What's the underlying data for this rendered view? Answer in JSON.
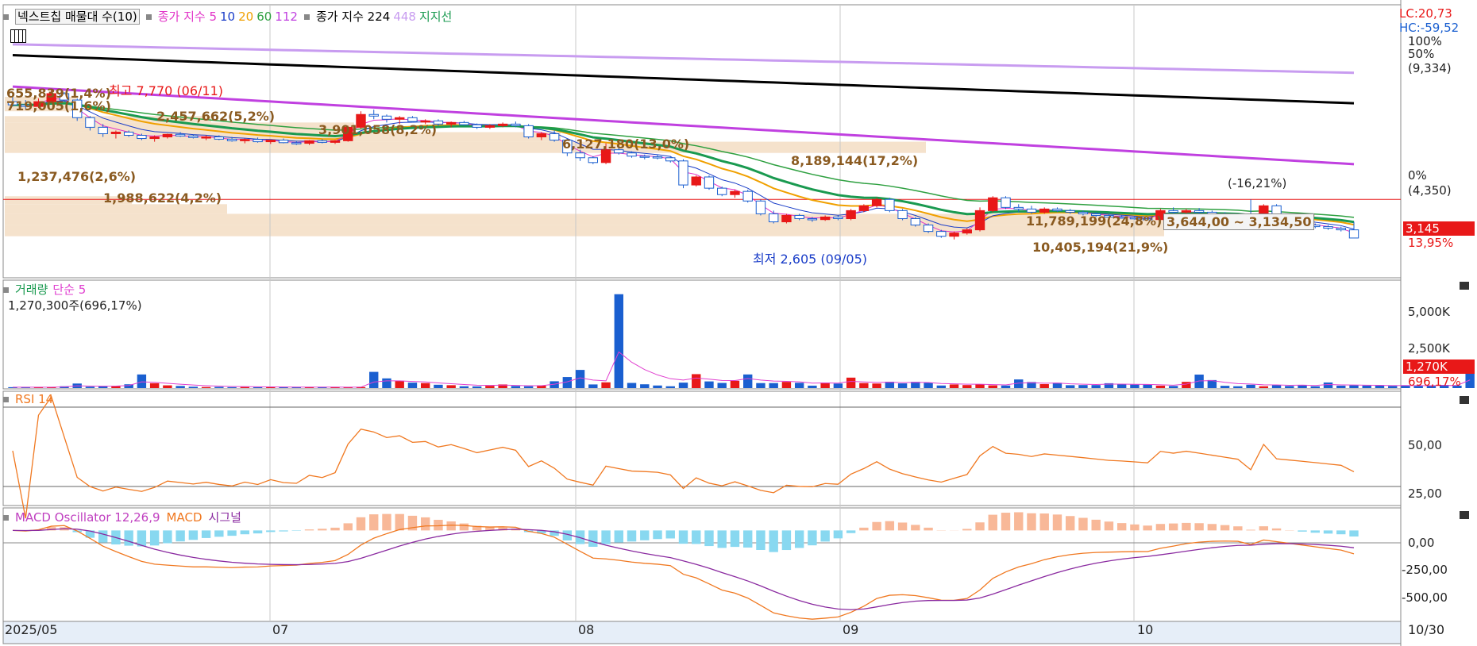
{
  "colors": {
    "up": "#e81818",
    "down": "#1a5fd0",
    "ma5": "#e234c8",
    "ma10": "#1a3dc8",
    "ma20": "#f0a000",
    "ma60": "#2ea040",
    "ma112": "#c040e0",
    "ma224": "#000000",
    "ma448": "#c89cf0",
    "support": "#1a9a50",
    "vol_ma": "#e040d0",
    "rsi": "#f07820",
    "macd": "#f07820",
    "signal": "#8a2aa0",
    "osc_pos": "#f8b898",
    "osc_neg": "#88d8f0",
    "profile": "#f5e2cc",
    "grid": "#c8c8c8"
  },
  "main_legend": {
    "profile_label": "넥스트칩 매물대 수(10)",
    "ma_prefix": "종가 지수 5",
    "ma10": "10",
    "ma20": "20",
    "ma60": "60",
    "ma112": "112",
    "ma224_label": "종가 지수 224",
    "ma448": "448",
    "support_label": "지지선"
  },
  "main_annotations": {
    "lc": "LC:20,73",
    "hc": "HC:-59,52",
    "high": "최고 7,770 (06/11)",
    "low": "최저 2,605 (09/05)",
    "change": "(-16,21%)",
    "range_box": "3,644,00 ~ 3,134,50",
    "price_badge": "3,145",
    "price_pct": "13,95%"
  },
  "profile_labels": [
    "655,839(1,4%)",
    "719,005(1,6%)",
    "2,457,662(5,2%)",
    "3,901,058(8,2%)",
    "6,127,180(13,0%)",
    "8,189,144(17,2%)",
    "1,237,476(2,6%)",
    "1,988,622(4,2%)",
    "11,789,199(24,8%)",
    "10,405,194(21,9%)"
  ],
  "price_axis": [
    "100%",
    "50%",
    "(9,334)",
    "0%",
    "(4,350)"
  ],
  "volume_panel": {
    "title": "거래량",
    "ma_label": "단순 5",
    "value": "1,270,300주(696,17%)",
    "axis": [
      "5,000K",
      "2,500K"
    ],
    "badge": "1,270K",
    "badge_pct": "696,17%"
  },
  "rsi_panel": {
    "title": "RSI 14",
    "axis": [
      "50,00",
      "25,00"
    ]
  },
  "macd_panel": {
    "title": "MACD Oscillator 12,26,9",
    "macd_label": "MACD",
    "signal_label": "시그널",
    "axis": [
      "0,00",
      "-250,00",
      "-500,00"
    ]
  },
  "x_axis": [
    "2025/05",
    "07",
    "08",
    "09",
    "10",
    "10/30"
  ],
  "chart_data": [
    {
      "type": "candlestick",
      "title": "넥스트칩",
      "ylim": [
        2400,
        9334
      ],
      "candles": [
        {
          "o": 7400,
          "h": 7600,
          "l": 7250,
          "c": 7300
        },
        {
          "o": 7300,
          "h": 7450,
          "l": 7150,
          "c": 7250
        },
        {
          "o": 7250,
          "h": 7500,
          "l": 7200,
          "c": 7400
        },
        {
          "o": 7400,
          "h": 7770,
          "l": 7350,
          "c": 7650
        },
        {
          "o": 7650,
          "h": 7700,
          "l": 7400,
          "c": 7450
        },
        {
          "o": 7450,
          "h": 7500,
          "l": 6800,
          "c": 6900
        },
        {
          "o": 6900,
          "h": 6950,
          "l": 6500,
          "c": 6600
        },
        {
          "o": 6600,
          "h": 6700,
          "l": 6300,
          "c": 6400
        },
        {
          "o": 6400,
          "h": 6500,
          "l": 6250,
          "c": 6450
        },
        {
          "o": 6450,
          "h": 6500,
          "l": 6300,
          "c": 6350
        },
        {
          "o": 6350,
          "h": 6400,
          "l": 6200,
          "c": 6250
        },
        {
          "o": 6250,
          "h": 6350,
          "l": 6150,
          "c": 6300
        },
        {
          "o": 6300,
          "h": 6400,
          "l": 6250,
          "c": 6380
        },
        {
          "o": 6380,
          "h": 6450,
          "l": 6300,
          "c": 6330
        },
        {
          "o": 6330,
          "h": 6380,
          "l": 6250,
          "c": 6280
        },
        {
          "o": 6280,
          "h": 6350,
          "l": 6200,
          "c": 6300
        },
        {
          "o": 6300,
          "h": 6350,
          "l": 6200,
          "c": 6230
        },
        {
          "o": 6230,
          "h": 6300,
          "l": 6150,
          "c": 6180
        },
        {
          "o": 6180,
          "h": 6250,
          "l": 6100,
          "c": 6220
        },
        {
          "o": 6220,
          "h": 6280,
          "l": 6120,
          "c": 6150
        },
        {
          "o": 6150,
          "h": 6220,
          "l": 6080,
          "c": 6200
        },
        {
          "o": 6200,
          "h": 6250,
          "l": 6100,
          "c": 6120
        },
        {
          "o": 6120,
          "h": 6180,
          "l": 6050,
          "c": 6100
        },
        {
          "o": 6100,
          "h": 6200,
          "l": 6050,
          "c": 6180
        },
        {
          "o": 6180,
          "h": 6230,
          "l": 6100,
          "c": 6130
        },
        {
          "o": 6130,
          "h": 6200,
          "l": 6080,
          "c": 6180
        },
        {
          "o": 6180,
          "h": 6650,
          "l": 6150,
          "c": 6600
        },
        {
          "o": 6600,
          "h": 7100,
          "l": 6550,
          "c": 7000
        },
        {
          "o": 7000,
          "h": 7150,
          "l": 6850,
          "c": 6950
        },
        {
          "o": 6950,
          "h": 7000,
          "l": 6750,
          "c": 6850
        },
        {
          "o": 6850,
          "h": 6950,
          "l": 6700,
          "c": 6900
        },
        {
          "o": 6900,
          "h": 6950,
          "l": 6750,
          "c": 6780
        },
        {
          "o": 6780,
          "h": 6850,
          "l": 6700,
          "c": 6800
        },
        {
          "o": 6800,
          "h": 6850,
          "l": 6650,
          "c": 6700
        },
        {
          "o": 6700,
          "h": 6780,
          "l": 6600,
          "c": 6750
        },
        {
          "o": 6750,
          "h": 6800,
          "l": 6650,
          "c": 6680
        },
        {
          "o": 6680,
          "h": 6720,
          "l": 6550,
          "c": 6600
        },
        {
          "o": 6600,
          "h": 6700,
          "l": 6550,
          "c": 6650
        },
        {
          "o": 6650,
          "h": 6750,
          "l": 6600,
          "c": 6700
        },
        {
          "o": 6700,
          "h": 6780,
          "l": 6600,
          "c": 6650
        },
        {
          "o": 6650,
          "h": 6700,
          "l": 6250,
          "c": 6300
        },
        {
          "o": 6300,
          "h": 6450,
          "l": 6200,
          "c": 6400
        },
        {
          "o": 6400,
          "h": 6500,
          "l": 6150,
          "c": 6200
        },
        {
          "o": 6200,
          "h": 6250,
          "l": 5700,
          "c": 5800
        },
        {
          "o": 5800,
          "h": 5900,
          "l": 5550,
          "c": 5650
        },
        {
          "o": 5650,
          "h": 5700,
          "l": 5450,
          "c": 5500
        },
        {
          "o": 5500,
          "h": 6100,
          "l": 5450,
          "c": 5900
        },
        {
          "o": 5900,
          "h": 6050,
          "l": 5750,
          "c": 5800
        },
        {
          "o": 5800,
          "h": 5850,
          "l": 5650,
          "c": 5700
        },
        {
          "o": 5700,
          "h": 5750,
          "l": 5600,
          "c": 5680
        },
        {
          "o": 5680,
          "h": 5750,
          "l": 5600,
          "c": 5650
        },
        {
          "o": 5650,
          "h": 5700,
          "l": 5500,
          "c": 5550
        },
        {
          "o": 5550,
          "h": 5600,
          "l": 4700,
          "c": 4800
        },
        {
          "o": 4800,
          "h": 5100,
          "l": 4750,
          "c": 5050
        },
        {
          "o": 5050,
          "h": 5100,
          "l": 4650,
          "c": 4700
        },
        {
          "o": 4700,
          "h": 4750,
          "l": 4450,
          "c": 4500
        },
        {
          "o": 4500,
          "h": 4650,
          "l": 4400,
          "c": 4600
        },
        {
          "o": 4600,
          "h": 4650,
          "l": 4250,
          "c": 4300
        },
        {
          "o": 4300,
          "h": 4350,
          "l": 3850,
          "c": 3900
        },
        {
          "o": 3900,
          "h": 4000,
          "l": 3600,
          "c": 3650
        },
        {
          "o": 3650,
          "h": 3900,
          "l": 3600,
          "c": 3850
        },
        {
          "o": 3850,
          "h": 3900,
          "l": 3700,
          "c": 3750
        },
        {
          "o": 3750,
          "h": 3800,
          "l": 3650,
          "c": 3720
        },
        {
          "o": 3720,
          "h": 3850,
          "l": 3680,
          "c": 3800
        },
        {
          "o": 3800,
          "h": 3850,
          "l": 3700,
          "c": 3750
        },
        {
          "o": 3750,
          "h": 4050,
          "l": 3700,
          "c": 4000
        },
        {
          "o": 4000,
          "h": 4200,
          "l": 3950,
          "c": 4150
        },
        {
          "o": 4150,
          "h": 4400,
          "l": 4100,
          "c": 4350
        },
        {
          "o": 4350,
          "h": 4400,
          "l": 3950,
          "c": 4000
        },
        {
          "o": 4000,
          "h": 4050,
          "l": 3700,
          "c": 3750
        },
        {
          "o": 3750,
          "h": 3800,
          "l": 3500,
          "c": 3550
        },
        {
          "o": 3550,
          "h": 3600,
          "l": 3300,
          "c": 3350
        },
        {
          "o": 3350,
          "h": 3400,
          "l": 3150,
          "c": 3200
        },
        {
          "o": 3200,
          "h": 3350,
          "l": 3100,
          "c": 3300
        },
        {
          "o": 3300,
          "h": 3450,
          "l": 3250,
          "c": 3400
        },
        {
          "o": 3400,
          "h": 4100,
          "l": 3350,
          "c": 4000
        },
        {
          "o": 4000,
          "h": 4450,
          "l": 3950,
          "c": 4400
        },
        {
          "o": 4400,
          "h": 4450,
          "l": 4050,
          "c": 4100
        },
        {
          "o": 4100,
          "h": 4200,
          "l": 3950,
          "c": 4050
        },
        {
          "o": 4050,
          "h": 4150,
          "l": 3900,
          "c": 3950
        },
        {
          "o": 3950,
          "h": 4100,
          "l": 3900,
          "c": 4050
        },
        {
          "o": 4050,
          "h": 4100,
          "l": 3950,
          "c": 4000
        },
        {
          "o": 4000,
          "h": 4050,
          "l": 3900,
          "c": 3950
        },
        {
          "o": 3950,
          "h": 4000,
          "l": 3850,
          "c": 3900
        },
        {
          "o": 3900,
          "h": 3950,
          "l": 3800,
          "c": 3850
        },
        {
          "o": 3850,
          "h": 3900,
          "l": 3750,
          "c": 3800
        },
        {
          "o": 3800,
          "h": 3850,
          "l": 3750,
          "c": 3780
        },
        {
          "o": 3780,
          "h": 3820,
          "l": 3720,
          "c": 3750
        },
        {
          "o": 3750,
          "h": 3800,
          "l": 3700,
          "c": 3720
        },
        {
          "o": 3720,
          "h": 4050,
          "l": 3700,
          "c": 4000
        },
        {
          "o": 4000,
          "h": 4100,
          "l": 3900,
          "c": 3950
        },
        {
          "o": 3950,
          "h": 4050,
          "l": 3900,
          "c": 4000
        },
        {
          "o": 4000,
          "h": 4080,
          "l": 3900,
          "c": 3950
        },
        {
          "o": 3950,
          "h": 4000,
          "l": 3850,
          "c": 3900
        },
        {
          "o": 3900,
          "h": 3950,
          "l": 3800,
          "c": 3850
        },
        {
          "o": 3850,
          "h": 3900,
          "l": 3750,
          "c": 3800
        },
        {
          "o": 3800,
          "h": 4350,
          "l": 3750,
          "c": 3500
        },
        {
          "o": 3500,
          "h": 4200,
          "l": 3450,
          "c": 4150
        },
        {
          "o": 4150,
          "h": 4200,
          "l": 3600,
          "c": 3650
        },
        {
          "o": 3650,
          "h": 3700,
          "l": 3550,
          "c": 3600
        },
        {
          "o": 3600,
          "h": 3650,
          "l": 3500,
          "c": 3550
        },
        {
          "o": 3550,
          "h": 3600,
          "l": 3450,
          "c": 3500
        },
        {
          "o": 3500,
          "h": 3550,
          "l": 3400,
          "c": 3450
        },
        {
          "o": 3450,
          "h": 3500,
          "l": 3350,
          "c": 3400
        },
        {
          "o": 3400,
          "h": 3650,
          "l": 3350,
          "c": 3145
        }
      ]
    },
    {
      "type": "bar",
      "title": "거래량",
      "ylim": [
        0,
        6500
      ],
      "values": [
        60,
        50,
        55,
        60,
        120,
        300,
        90,
        110,
        140,
        250,
        900,
        320,
        180,
        140,
        90,
        70,
        80,
        60,
        70,
        60,
        65,
        60,
        55,
        60,
        70,
        60,
        50,
        70,
        1070,
        640,
        480,
        360,
        330,
        220,
        190,
        120,
        110,
        150,
        240,
        140,
        120,
        160,
        450,
        730,
        1200,
        240,
        380,
        6200,
        340,
        250,
        170,
        120,
        360,
        920,
        440,
        340,
        480,
        900,
        330,
        330,
        410,
        350,
        160,
        360,
        300,
        690,
        330,
        300,
        420,
        310,
        410,
        350,
        170,
        240,
        200,
        250,
        180,
        170,
        570,
        400,
        260,
        350,
        190,
        200,
        200,
        320,
        260,
        230,
        230,
        160,
        140,
        410,
        890,
        530,
        150,
        120,
        220,
        120,
        190,
        140,
        210,
        120,
        370,
        160,
        180,
        170,
        160,
        140,
        180,
        140,
        150,
        210,
        160,
        1270
      ],
      "colors": "up/down by candle"
    },
    {
      "type": "line",
      "title": "RSI 14",
      "ylim": [
        10,
        90
      ]
    },
    {
      "type": "bar",
      "title": "MACD Oscillator 12,26,9",
      "ylim": [
        -680,
        110
      ]
    }
  ]
}
